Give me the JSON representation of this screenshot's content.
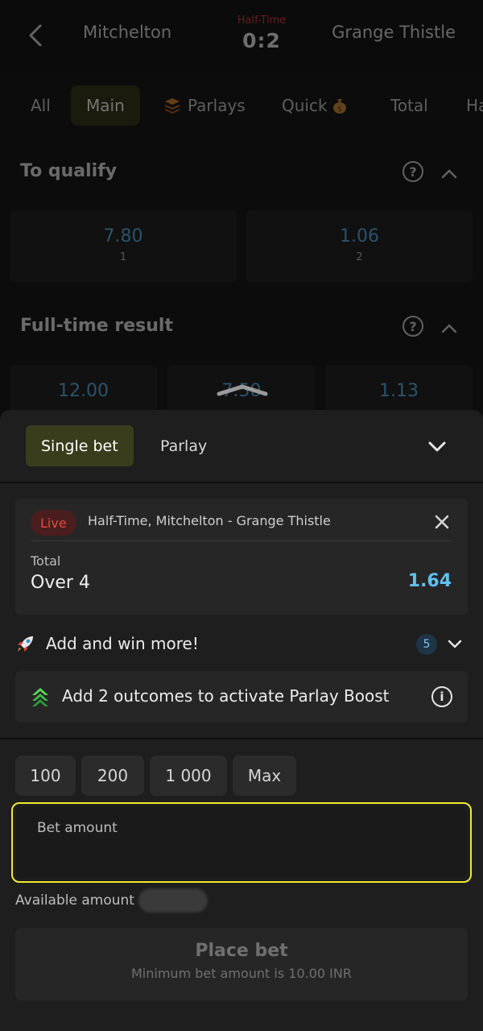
{
  "match": {
    "home_team": "Mitchelton",
    "away_team": "Grange Thistle",
    "status": "Half-Time",
    "score": "0:2"
  },
  "tabs": [
    {
      "label": "All"
    },
    {
      "label": "Main"
    },
    {
      "label": "Parlays",
      "icon": "parlays-stack-icon"
    },
    {
      "label": "Quick",
      "icon": "money-bag-icon"
    },
    {
      "label": "Total"
    },
    {
      "label": "Ha"
    }
  ],
  "active_tab": "Main",
  "markets": {
    "qualify": {
      "title": "To qualify",
      "odds": [
        {
          "value": "7.80",
          "label": "1"
        },
        {
          "value": "1.06",
          "label": "2"
        }
      ]
    },
    "fulltime": {
      "title": "Full-time result",
      "odds": [
        {
          "value": "12.00"
        },
        {
          "value": "7.50"
        },
        {
          "value": "1.13"
        }
      ]
    }
  },
  "betslip": {
    "tabs": [
      "Single bet",
      "Parlay"
    ],
    "active": "Single bet",
    "selection": {
      "badge": "Live",
      "event": "Half-Time, Mitchelton - Grange Thistle",
      "market": "Total",
      "outcome": "Over 4",
      "odd": "1.64"
    },
    "add_win": {
      "label": "Add and win more!",
      "count": "5"
    },
    "boost": {
      "text": "Add 2 outcomes to activate Parlay Boost"
    },
    "quick_amounts": [
      "100",
      "200",
      "1 000",
      "Max"
    ],
    "amount_label": "Bet amount",
    "amount_value": "",
    "available_label": "Available amount",
    "place_bet": {
      "label": "Place bet",
      "subtitle": "Minimum bet amount is 10.00 INR"
    }
  },
  "colors": {
    "accent_tab": "#3a3d1c",
    "odds_blue": "#5db5ee",
    "live_red": "#e34b3f",
    "focus_yellow": "#f2ea2f"
  }
}
